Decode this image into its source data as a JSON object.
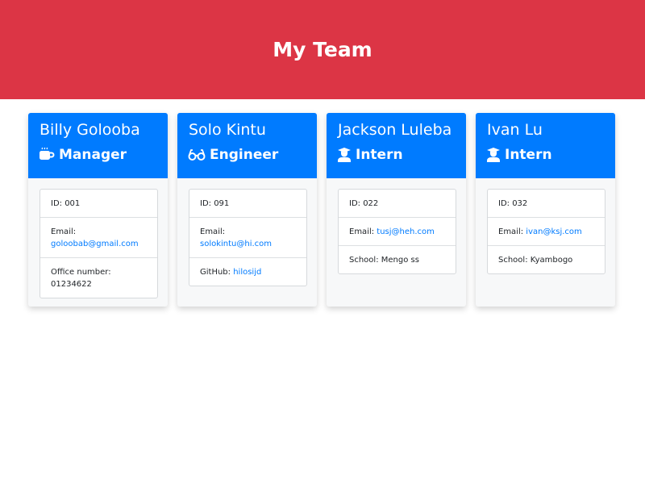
{
  "header": {
    "title": "My Team"
  },
  "colors": {
    "header_bg": "#dc3545",
    "card_header_bg": "#007bff",
    "link": "#007bff"
  },
  "cards": [
    {
      "name": "Billy Golooba",
      "role": "Manager",
      "role_icon": "coffee-mug-icon",
      "id": "ID: 001",
      "email_label": "Email:",
      "email": "goloobab@gmail.com",
      "extra_label": "Office number:",
      "extra_value": "01234622"
    },
    {
      "name": "Solo Kintu",
      "role": "Engineer",
      "role_icon": "glasses-icon",
      "id": "ID: 091",
      "email_label": "Email:",
      "email": "solokintu@hi.com",
      "extra_label": "GitHub:",
      "extra_value": "hilosijd"
    },
    {
      "name": "Jackson Luleba",
      "role": "Intern",
      "role_icon": "graduate-icon",
      "id": "ID: 022",
      "email_label": "Email:",
      "email": "tusj@heh.com",
      "extra_label": "School:",
      "extra_value": "Mengo ss"
    },
    {
      "name": "Ivan Lu",
      "role": "Intern",
      "role_icon": "graduate-icon",
      "id": "ID: 032",
      "email_label": "Email:",
      "email": "ivan@ksj.com",
      "extra_label": "School:",
      "extra_value": "Kyambogo"
    }
  ]
}
